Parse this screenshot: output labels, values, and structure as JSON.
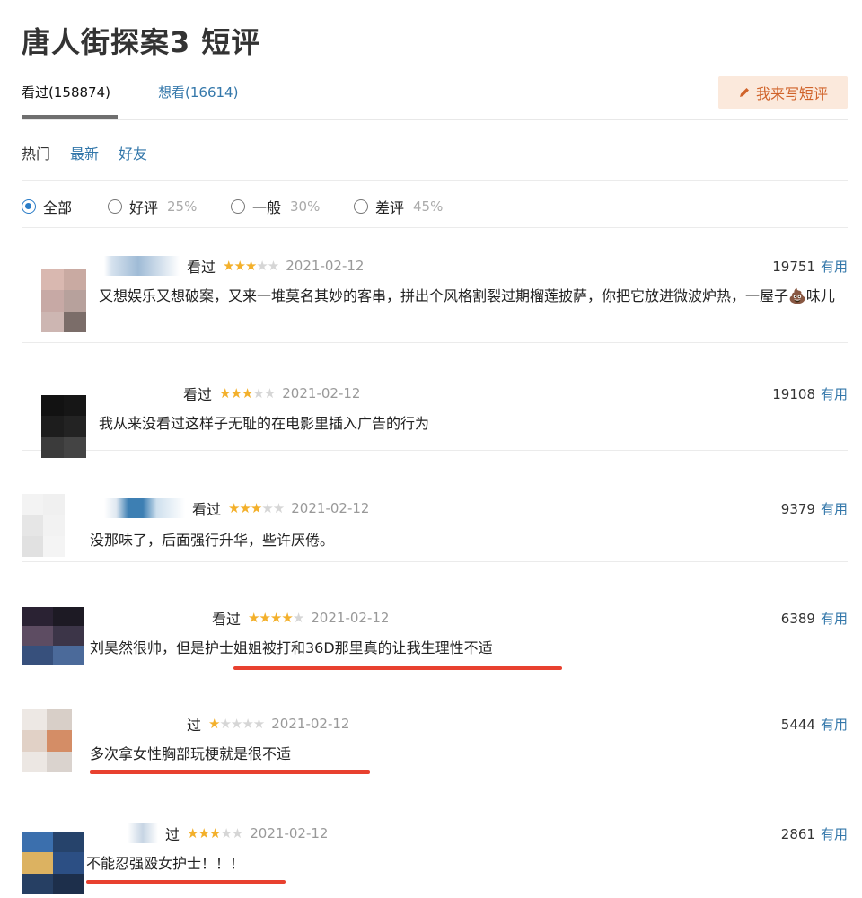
{
  "page": {
    "title": "唐人街探案3 短评"
  },
  "tabs": {
    "watched": "看过(158874)",
    "wish": "想看(16614)",
    "write_button": "我来写短评"
  },
  "sort": {
    "hot": "热门",
    "latest": "最新",
    "friends": "好友"
  },
  "filter": {
    "all": "全部",
    "good": "好评",
    "good_pct": "25%",
    "neutral": "一般",
    "neutral_pct": "30%",
    "bad": "差评",
    "bad_pct": "45%",
    "selected": "all"
  },
  "colors": {
    "link": "#3377aa",
    "star": "#f3b02b",
    "highlight": "#e8412f",
    "write_btn_bg": "#fbe9dc"
  },
  "reviews": [
    {
      "status": "看过",
      "rating": 3,
      "date": "2021-02-12",
      "votes": "19751",
      "useful": "有用",
      "content": "又想娱乐又想破案，又来一堆莫名其妙的客串，拼出个风格割裂过期榴莲披萨，你把它放进微波炉热，一屋子💩味儿"
    },
    {
      "status": "看过",
      "rating": 3,
      "date": "2021-02-12",
      "votes": "19108",
      "useful": "有用",
      "content": "我从来没看过这样子无耻的在电影里插入广告的行为"
    },
    {
      "status": "看过",
      "rating": 3,
      "date": "2021-02-12",
      "votes": "9379",
      "useful": "有用",
      "content": "没那味了，后面强行升华，些许厌倦。"
    },
    {
      "status": "看过",
      "rating": 4,
      "date": "2021-02-12",
      "votes": "6389",
      "useful": "有用",
      "content": "刘昊然很帅，但是护士姐姐被打和36D那里真的让我生理性不适"
    },
    {
      "status": "过",
      "rating": 1,
      "date": "2021-02-12",
      "votes": "5444",
      "useful": "有用",
      "content": "多次拿女性胸部玩梗就是很不适"
    },
    {
      "status": "过",
      "rating": 3,
      "date": "2021-02-12",
      "votes": "2861",
      "useful": "有用",
      "content": "不能忍强殴女护士！！！"
    }
  ]
}
